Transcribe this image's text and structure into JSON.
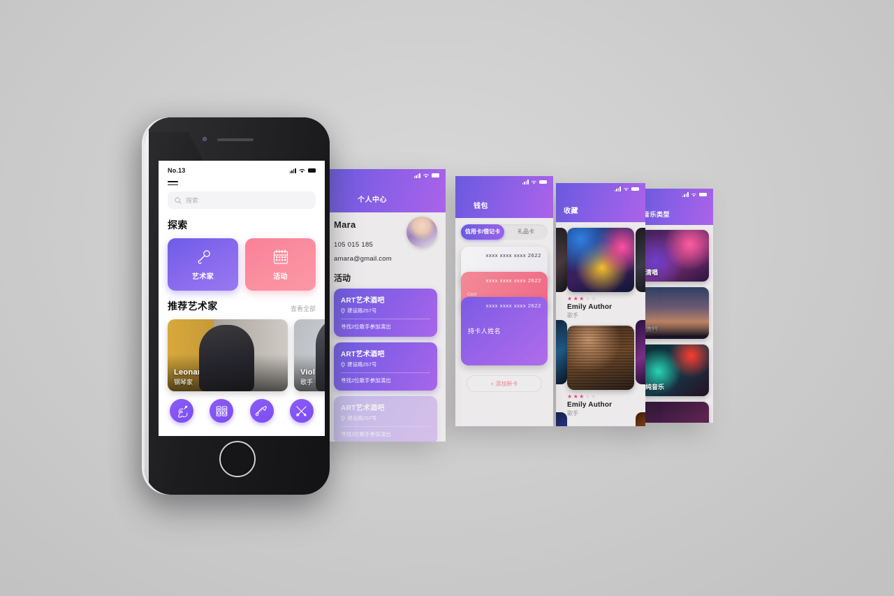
{
  "background": {
    "accent": "#7c4df2",
    "pink": "#fb8098"
  },
  "phone": {
    "status": {
      "carrier": "No.13",
      "signal_icon": "signal-bars-icon",
      "wifi_icon": "wifi-icon",
      "battery_icon": "battery-icon"
    },
    "menu_icon": "hamburger-menu-icon",
    "search": {
      "icon": "search-icon",
      "placeholder": "搜索",
      "value": ""
    },
    "explore": {
      "title": "探索",
      "tiles": [
        {
          "label": "艺术家",
          "icon": "microphone-icon"
        },
        {
          "label": "活动",
          "icon": "calendar-icon"
        }
      ]
    },
    "recommended": {
      "title": "推荐艺术家",
      "see_all": "查看全部",
      "artists": [
        {
          "name": "Leonard Evans",
          "role": "钢琴家"
        },
        {
          "name": "Viol",
          "role": "歌手"
        }
      ]
    },
    "instruments": [
      {
        "icon": "guitar-icon"
      },
      {
        "icon": "amplifier-icon"
      },
      {
        "icon": "trumpet-icon"
      },
      {
        "icon": "violin-icon"
      }
    ]
  },
  "profile_screen": {
    "title": "个人中心",
    "name": "Mara",
    "phone": "105 015 185",
    "email": "amara@gmail.com",
    "avatar": "user-avatar",
    "section_title": "活动",
    "events": [
      {
        "title": "ART艺术酒吧",
        "address": "建设路257号",
        "desc": "寻找2位歌手参加演出",
        "pin_icon": "location-pin-icon"
      },
      {
        "title": "ART艺术酒吧",
        "address": "建设路257号",
        "desc": "寻找2位歌手参加演出",
        "pin_icon": "location-pin-icon"
      },
      {
        "title": "ART艺术酒吧",
        "address": "建设路257号",
        "desc": "寻找2位歌手参加演出",
        "pin_icon": "location-pin-icon"
      }
    ]
  },
  "wallet_screen": {
    "title": "钱包",
    "tabs": [
      {
        "label": "信用卡/借记卡",
        "active": true
      },
      {
        "label": "礼品卡",
        "active": false
      }
    ],
    "cards": [
      {
        "number": "xxxx xxxx xxxx 2622",
        "holder": ""
      },
      {
        "number": "xxxx xxxx xxxx 2622",
        "holder": "",
        "label": "Card"
      },
      {
        "number": "xxxx xxxx xxxx 2622",
        "holder": "持卡人姓名"
      }
    ],
    "add_card_label": "+ 添加新卡"
  },
  "favorites_screen": {
    "title": "收藏",
    "items": [
      {
        "name": "Emily Author",
        "role": "歌手",
        "rating": 3,
        "max_rating": 5
      },
      {
        "name": "Emily Author",
        "role": "歌手",
        "rating": 3,
        "max_rating": 5
      }
    ]
  },
  "genres_screen": {
    "title": "音乐类型",
    "genres": [
      {
        "label": "清唱"
      },
      {
        "label": "流行"
      },
      {
        "label": "纯音乐"
      },
      {
        "label": ""
      }
    ]
  }
}
